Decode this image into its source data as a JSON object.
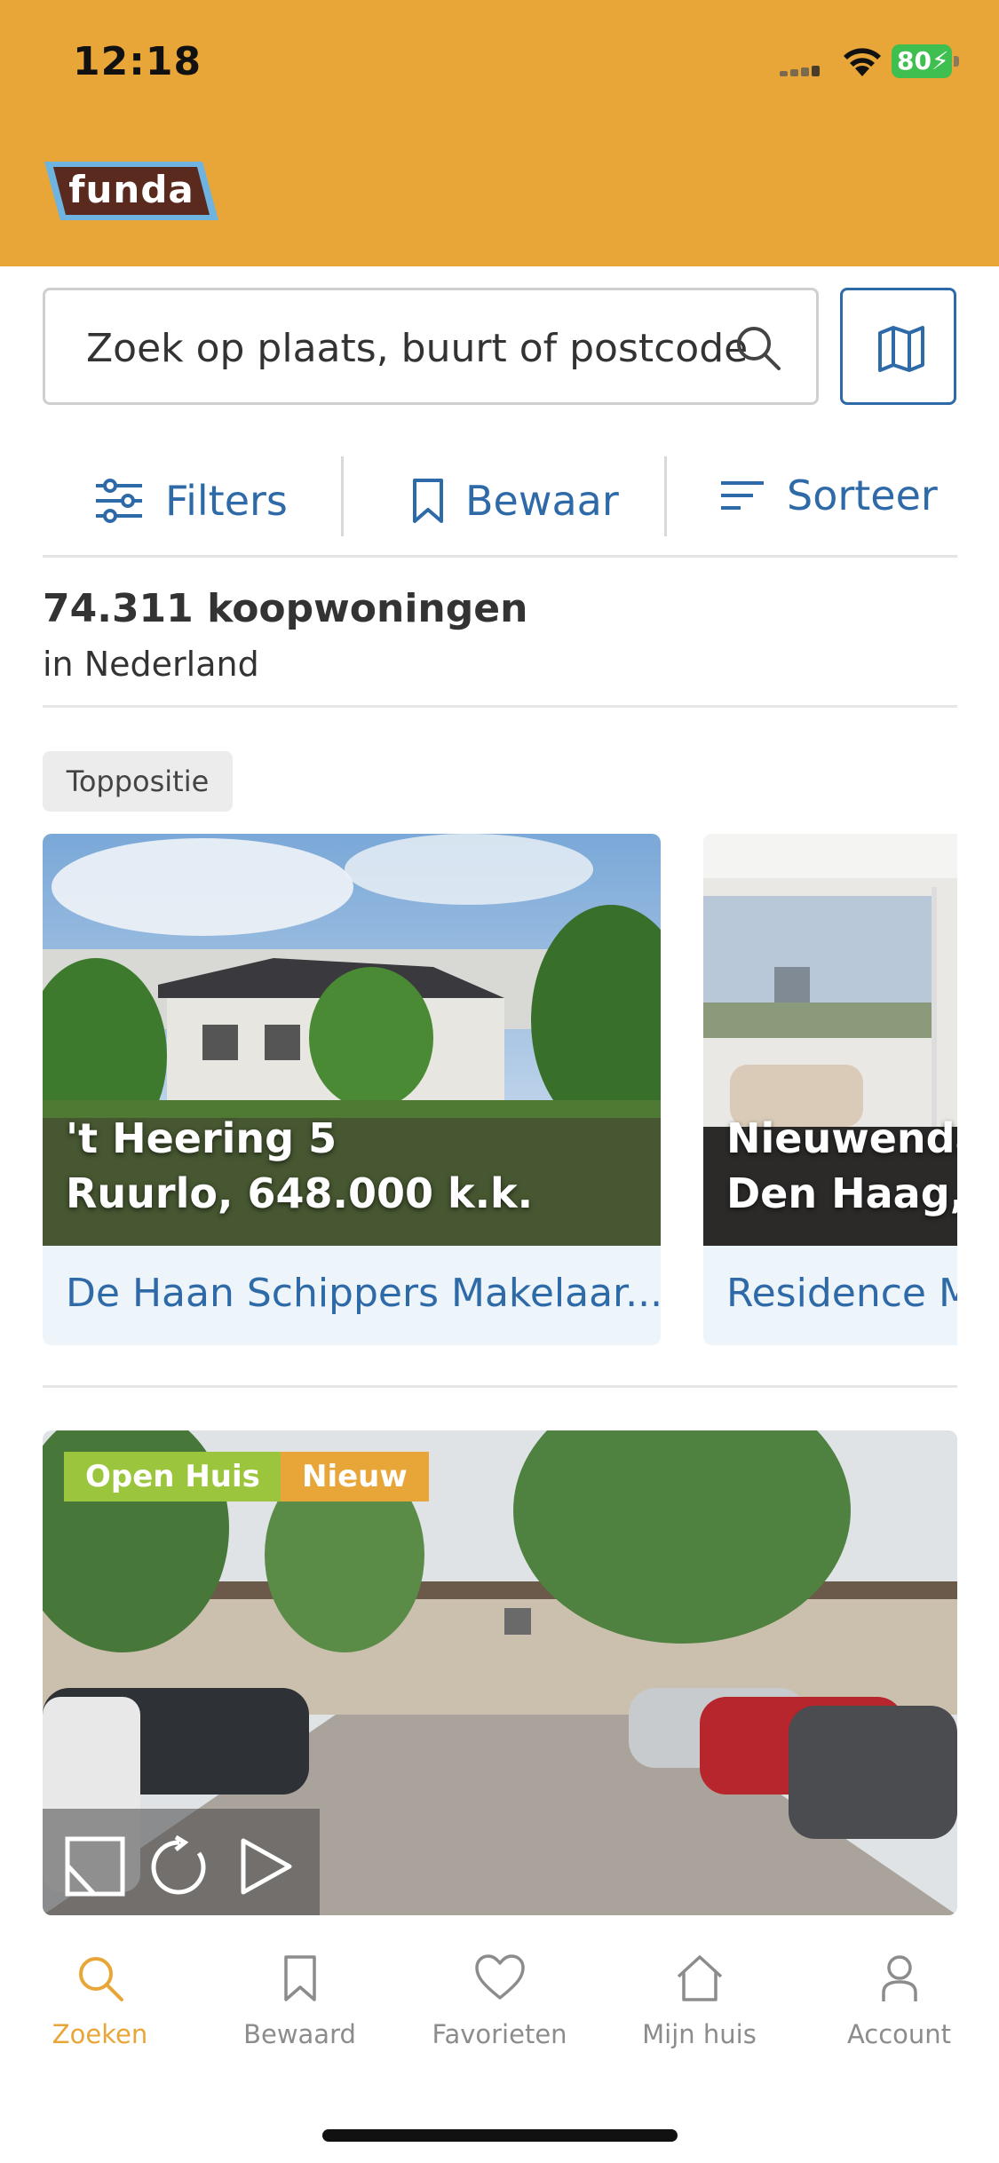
{
  "status_bar": {
    "time": "12:18",
    "battery": "80"
  },
  "header": {
    "logo": "funda",
    "brand_color": "#E9A638"
  },
  "search": {
    "placeholder": "Zoek op plaats, buurt of postcode"
  },
  "toolbar": {
    "filters": "Filters",
    "save": "Bewaar",
    "sort": "Sorteer"
  },
  "results": {
    "count": "74.311 koopwoningen",
    "region": "in Nederland"
  },
  "top_section": {
    "badge": "Toppositie",
    "cards": [
      {
        "line1": "'t Heering 5",
        "line2": "Ruurlo, 648.000 k.k.",
        "agent": "De Haan Schippers Makelaar..."
      },
      {
        "line1": "Nieuwenda",
        "line2": "Den Haag, ",
        "agent": "Residence M"
      }
    ]
  },
  "listing": {
    "tags": [
      "Open Huis",
      "Nieuw"
    ]
  },
  "bottom_nav": {
    "items": [
      {
        "label": "Zoeken",
        "icon": "search-icon",
        "active": true
      },
      {
        "label": "Bewaard",
        "icon": "bookmark-icon"
      },
      {
        "label": "Favorieten",
        "icon": "heart-icon"
      },
      {
        "label": "Mijn huis",
        "icon": "home-icon"
      },
      {
        "label": "Account",
        "icon": "person-icon"
      }
    ]
  },
  "colors": {
    "accent": "#E9A638",
    "link": "#2f6aa8",
    "open_house": "#9BC53D",
    "new": "#E9A638"
  }
}
